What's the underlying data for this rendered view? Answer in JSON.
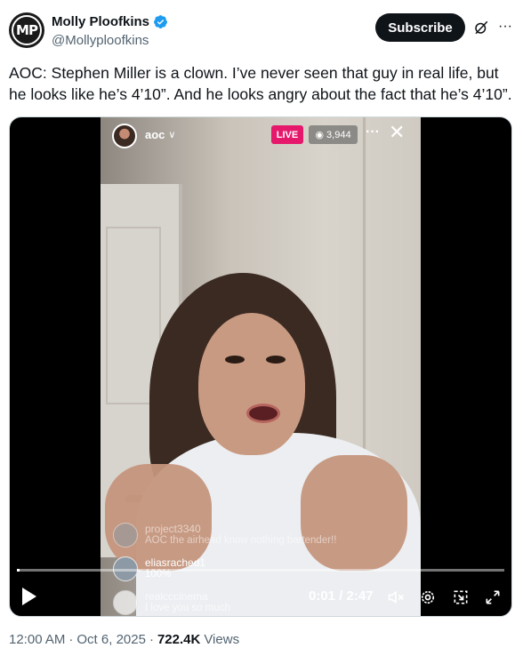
{
  "author": {
    "avatar_text": "MP",
    "display_name": "Molly Ploofkins",
    "handle": "@Mollyploofkins",
    "verified": true
  },
  "actions": {
    "subscribe_label": "Subscribe",
    "more_glyph": "···"
  },
  "tweet": {
    "text": "AOC: Stephen Miller is a clown. I’ve never seen that guy in real life, but he looks like he’s 4’10”. And he looks angry about the fact that he’s 4’10”."
  },
  "video": {
    "stream": {
      "username": "aoc",
      "live_label": "LIVE",
      "viewer_count": "3,944"
    },
    "comments": [
      {
        "user": "project3340",
        "text": "AOC the airhead know nothing bartender!!"
      },
      {
        "user": "eliasrached1",
        "text": "100%"
      },
      {
        "user": "realcccinema",
        "text": "I love you so much"
      }
    ],
    "time_display": "0:01 / 2:47",
    "progress_fraction": 0.006
  },
  "meta": {
    "time": "12:00 AM",
    "date": "Oct 6, 2025",
    "views_count": "722.4K",
    "views_label": "Views",
    "separator": "·"
  },
  "colors": {
    "text": "#0f1419",
    "secondary": "#536471",
    "verified": "#1d9bf0",
    "live": "#e6186c"
  },
  "icons": [
    "verified-badge-icon",
    "grok-icon",
    "more-icon",
    "play-icon",
    "volume-muted-icon",
    "settings-icon",
    "pip-icon",
    "fullscreen-icon",
    "close-icon",
    "eye-icon",
    "chevron-down-icon"
  ]
}
